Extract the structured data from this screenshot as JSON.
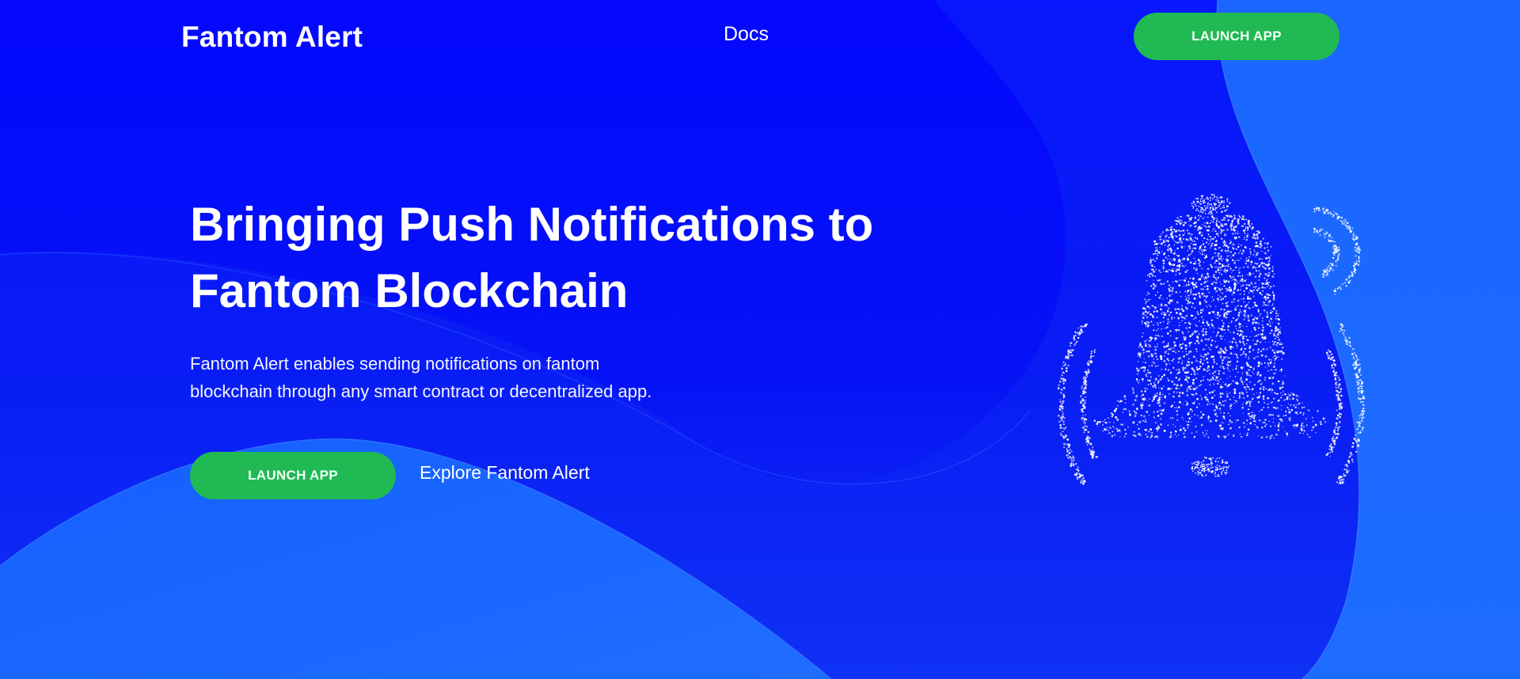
{
  "header": {
    "logo": "Fantom Alert",
    "nav_docs": "Docs",
    "launch_label": "LAUNCH APP"
  },
  "hero": {
    "title_line1": "Bringing Push Notifications to",
    "title_line2": "Fantom Blockchain",
    "desc_line1": "Fantom Alert enables sending notifications on fantom",
    "desc_line2": "blockchain through any smart contract or decentralized app.",
    "launch_label": "LAUNCH APP",
    "explore_label": "Explore Fantom Alert"
  },
  "illustration": {
    "icon": "particle-bell-icon"
  },
  "colors": {
    "background_deep": "#0408ff",
    "background_light": "#1b69ff",
    "accent_green": "#21b954",
    "text": "#ffffff"
  }
}
